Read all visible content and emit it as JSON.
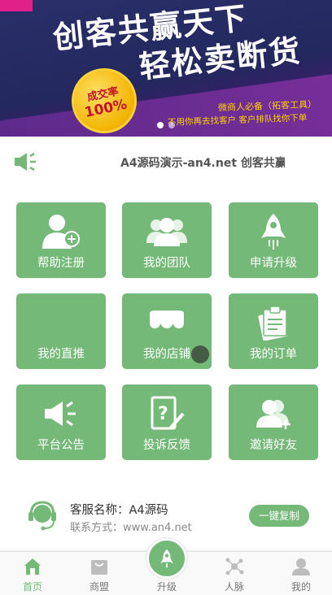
{
  "banner": {
    "headline_1": "创客共赢天下",
    "headline_2": "轻松卖断货",
    "badge_line_1": "成交率",
    "badge_line_2": "100%",
    "sub_line_1": "微商人必备（拓客工具）",
    "sub_line_2": "不用你再去找客户 客户排队找你下单",
    "slide_count": 2,
    "active_slide": 1
  },
  "notice": {
    "text": "A4源码演示-an4.net 创客共赢",
    "icon": "speaker-icon"
  },
  "menu": [
    {
      "label": "帮助注册",
      "icon": "user-add-icon"
    },
    {
      "label": "我的团队",
      "icon": "team-icon"
    },
    {
      "label": "申请升级",
      "icon": "rocket-icon"
    },
    {
      "label": "我的直推",
      "icon": "direct-icon"
    },
    {
      "label": "我的店铺",
      "icon": "store-icon"
    },
    {
      "label": "我的订单",
      "icon": "order-icon"
    },
    {
      "label": "平台公告",
      "icon": "megaphone-icon"
    },
    {
      "label": "投诉反馈",
      "icon": "feedback-icon"
    },
    {
      "label": "邀请好友",
      "icon": "invite-icon"
    }
  ],
  "service": {
    "name": "客服名称：A4源码",
    "contact": "联系方式：www.an4.net",
    "copy_button": "一键复制"
  },
  "nav": [
    {
      "label": "首页",
      "icon": "home-icon",
      "active": true
    },
    {
      "label": "商盟",
      "icon": "shop-bag-icon",
      "active": false
    },
    {
      "label": "升级",
      "icon": "rocket-icon",
      "active": false
    },
    {
      "label": "人脉",
      "icon": "network-icon",
      "active": false
    },
    {
      "label": "我的",
      "icon": "profile-icon",
      "active": false
    }
  ],
  "colors": {
    "accent": "#74b977",
    "banner_bg": "#23285e",
    "banner_text_yellow": "#ffd200"
  }
}
